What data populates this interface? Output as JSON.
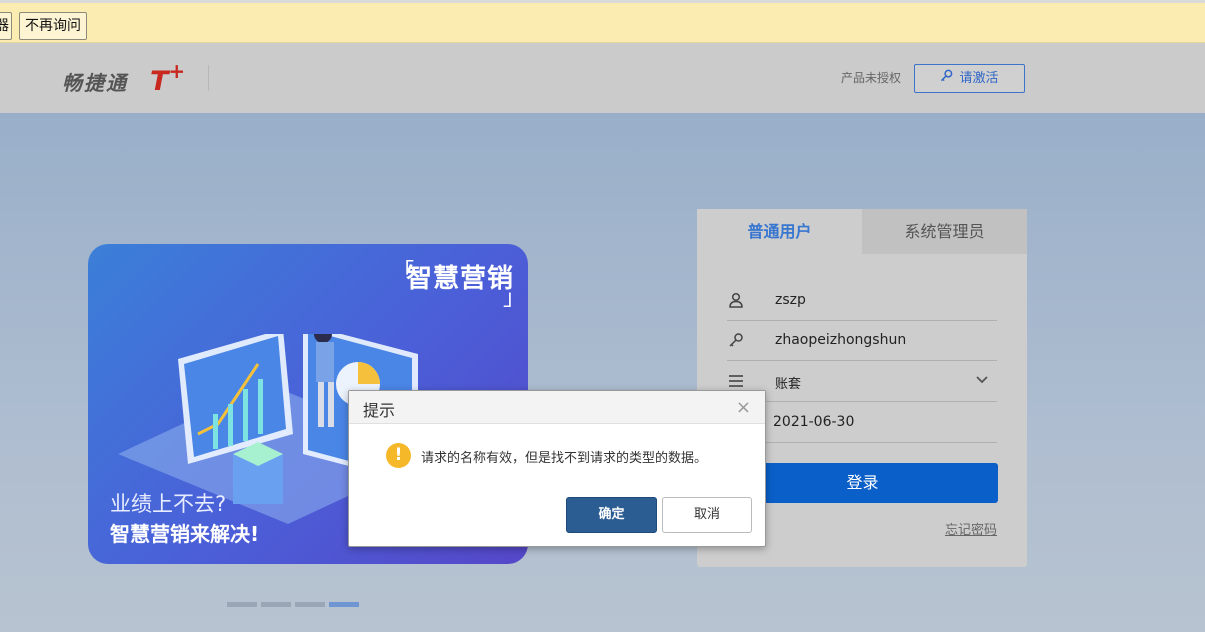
{
  "infobar": {
    "partial_button_label": "器",
    "no_ask_label": "不再询问"
  },
  "header": {
    "logo_text": "畅捷通",
    "logo_brand": "T",
    "logo_plus": "+",
    "auth_text": "产品未授权",
    "activate_label": "请激活"
  },
  "banner": {
    "title": "智慧营销",
    "bracket_open": "「",
    "bracket_close": "」",
    "line1": "业绩上不去?",
    "line2": "智慧营销来解决!"
  },
  "login": {
    "tab_user": "普通用户",
    "tab_admin": "系统管理员",
    "username": "zszp",
    "password": "zhaopeizhongshun",
    "account_set": "账套",
    "date": "2021-06-30",
    "login_label": "登录",
    "forgot_label": "忘记密码"
  },
  "dialog": {
    "title": "提示",
    "close": "×",
    "message": "请求的名称有效，但是找不到请求的类型的数据。",
    "ok_label": "确定",
    "cancel_label": "取消",
    "icon": "exclamation-icon"
  },
  "carousel": {
    "total": 4,
    "active_index": 3
  },
  "colors": {
    "accent": "#0a5fc8",
    "infobar": "#fbedb2",
    "header": "#cbcbcb",
    "banner": "#4b5fd8",
    "warning": "#f5b829"
  }
}
